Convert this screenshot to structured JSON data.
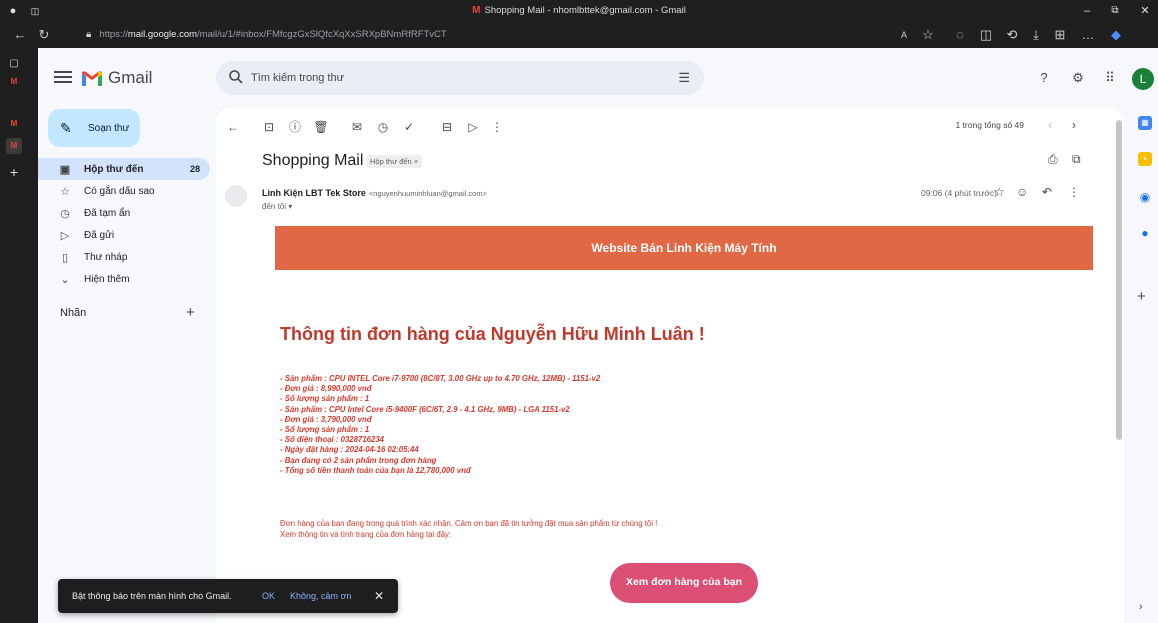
{
  "browser": {
    "window_title": "Shopping Mail - nhomlbttek@gmail.com - Gmail",
    "url_prefix": "https://",
    "url_domain": "mail.google.com",
    "url_path": "/mail/u/1/#inbox/FMfcgzGxSlQfcXqXxSRXpBNmRfRFTvCT"
  },
  "gmail": {
    "brand": "Gmail",
    "search_placeholder": "Tìm kiếm trong thư",
    "avatar_letter": "L"
  },
  "sidebar": {
    "compose_label": "Soạn thư",
    "items": [
      {
        "label": "Hộp thư đến",
        "count": "28",
        "icon": "inbox-icon"
      },
      {
        "label": "Có gắn dấu sao",
        "icon": "star-icon"
      },
      {
        "label": "Đã tạm ẩn",
        "icon": "clock-icon"
      },
      {
        "label": "Đã gửi",
        "icon": "send-icon"
      },
      {
        "label": "Thư nháp",
        "icon": "draft-icon"
      },
      {
        "label": "Hiện thêm",
        "icon": "chevron-down-icon"
      }
    ],
    "labels_title": "Nhãn"
  },
  "toolbar": {
    "pager": "1 trong tổng số 49"
  },
  "email": {
    "subject": "Shopping Mail",
    "inbox_chip": "Hộp thư đến ×",
    "sender_name": "Linh Kiện LBT Tek Store",
    "sender_email": "<nguyenhuuminhluan@gmail.com>",
    "to_me": "đến tôi ▾",
    "time": "09:06 (4 phút trước)",
    "banner": "Website Bán Linh Kiện Máy Tính",
    "order_title": "Thông tin đơn hàng của Nguyễn Hữu Minh Luân !",
    "details": [
      "- Sản phẩm : CPU INTEL Core i7-9700 (8C/8T, 3.00 GHz up to 4.70 GHz, 12MB) - 1151-v2",
      "- Đơn giá : 8,990,000 vnđ",
      "- Số lượng sản phẩm : 1",
      "- Sản phẩm : CPU Intel Core i5-9400F (6C/6T, 2.9 - 4.1 GHz, 9MB) - LGA 1151-v2",
      "- Đơn giá : 3,790,000 vnđ",
      "- Số lượng sản phẩm : 1",
      "- Số điện thoại : 0328716234",
      "- Ngày đặt hàng : 2024-04-16 02:05:44",
      "- Bạn đang có 2 sản phẩm trong đơn hàng",
      "- Tổng số tiền thanh toán của bạn là 12,780,000 vnđ"
    ],
    "note1": "Đơn hàng của bạn đang trong quá trình xác nhận. Cảm ơn bạn đã tin tưởng đặt mua sản phẩm từ chúng tôi !",
    "note2": "Xem thông tin và tình trạng của đơn hàng tại đây:",
    "button": "Xem đơn hàng của bạn"
  },
  "snackbar": {
    "message": "Bật thông báo trên màn hình cho Gmail.",
    "ok": "OK",
    "no": "Không, cảm ơn",
    "close": "✕"
  },
  "colors": {
    "banner": "#e06844",
    "order_text": "#d63a2c",
    "button": "#db4f75",
    "compose": "#c2e7ff",
    "active_nav": "#d3e3fd"
  }
}
